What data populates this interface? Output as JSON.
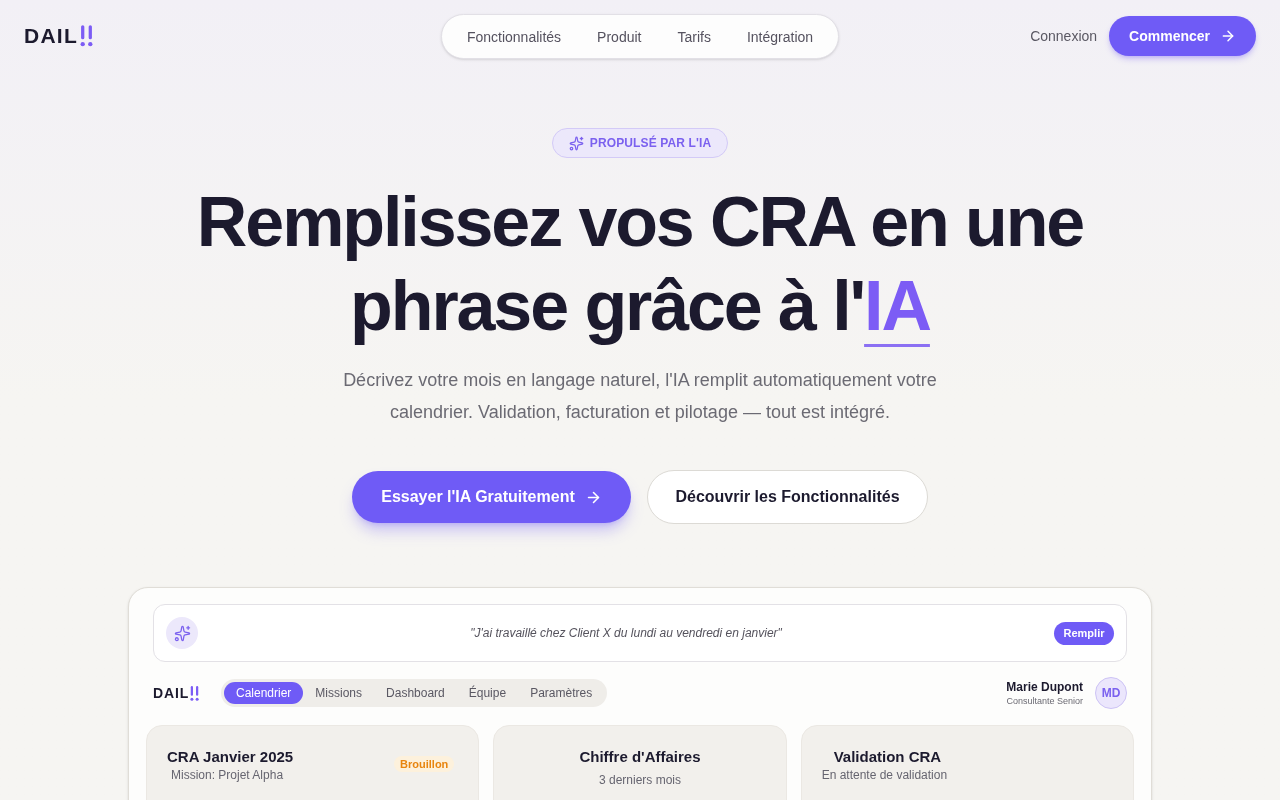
{
  "header": {
    "logo": "DAIL",
    "nav": [
      {
        "label": "Fonctionnalités"
      },
      {
        "label": "Produit"
      },
      {
        "label": "Tarifs"
      },
      {
        "label": "Intégration"
      }
    ],
    "login": "Connexion",
    "cta": "Commencer"
  },
  "hero": {
    "badge": "PROPULSÉ PAR L'IA",
    "title_lines": [
      "Remplissez vos CRA en une",
      "phrase grâce à l'"
    ],
    "title_highlight": "IA",
    "description": "Décrivez votre mois en langage naturel, l'IA remplit automatiquement votre calendrier. Validation, facturation et pilotage — tout est intégré.",
    "primary_button": "Essayer l'IA Gratuitement",
    "secondary_button": "Découvrir les Fonctionnalités"
  },
  "preview": {
    "prompt": {
      "text": "\"J'ai travaillé chez Client X du lundi au vendredi en janvier\"",
      "button": "Remplir"
    },
    "logo": "DAIL",
    "tabs": [
      {
        "label": "Calendrier",
        "selected": true
      },
      {
        "label": "Missions",
        "selected": false
      },
      {
        "label": "Dashboard",
        "selected": false
      },
      {
        "label": "Équipe",
        "selected": false
      },
      {
        "label": "Paramètres",
        "selected": false
      }
    ],
    "user": {
      "name": "Marie Dupont",
      "role": "Consultante Senior",
      "initials": "MD"
    },
    "cards": [
      {
        "kind": "status",
        "title": "CRA Janvier 2025",
        "subtitle": "Mission: Projet Alpha",
        "badge": "Brouillon"
      },
      {
        "kind": "chart",
        "title": "Chiffre d'Affaires",
        "subtitle": "3 derniers mois"
      },
      {
        "kind": "status",
        "title": "Validation CRA",
        "subtitle": "En attente de validation"
      }
    ]
  }
}
